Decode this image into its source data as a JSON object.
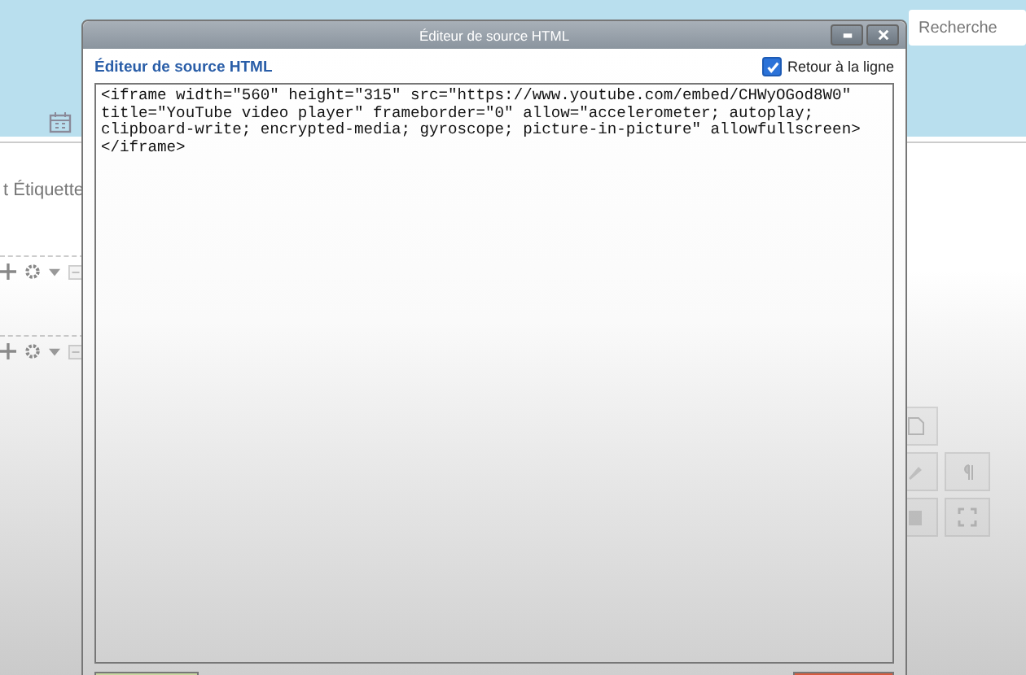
{
  "background": {
    "search": {
      "placeholder": "Recherche"
    },
    "label": "t Étiquette"
  },
  "dialog": {
    "title": "Éditeur de source HTML",
    "heading": "Éditeur de source HTML",
    "wrap_option": {
      "label": "Retour à la ligne",
      "checked": true
    },
    "source": "<iframe width=\"560\" height=\"315\" src=\"https://www.youtube.com/embed/CHWyOGod8W0\" title=\"YouTube video player\" frameborder=\"0\" allow=\"accelerometer; autoplay; clipboard-write; encrypted-media; gyroscope; picture-in-picture\" allowfullscreen></iframe>"
  }
}
